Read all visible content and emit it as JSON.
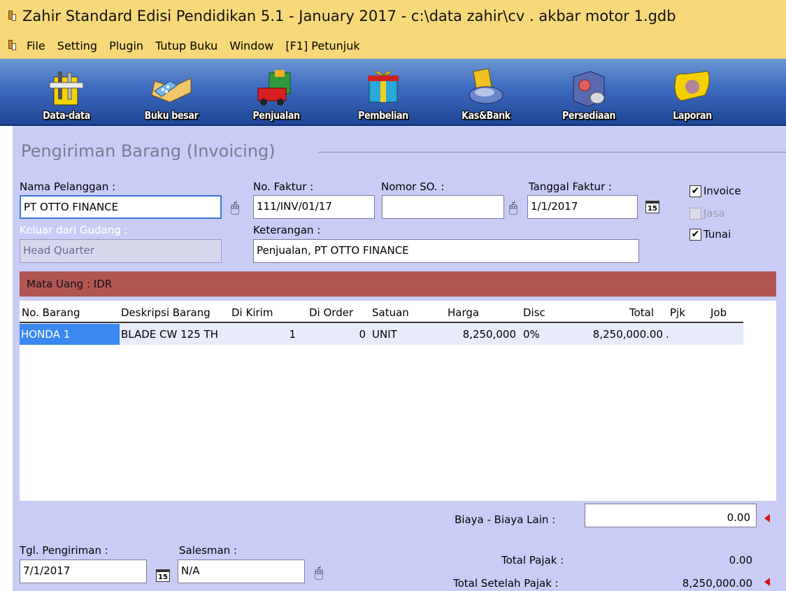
{
  "window": {
    "title": "Zahir Standard Edisi Pendidikan 5.1 - January 2017 - c:\\data zahir\\cv . akbar motor 1.gdb"
  },
  "menu": {
    "items": [
      "File",
      "Setting",
      "Plugin",
      "Tutup Buku",
      "Window",
      "[F1] Petunjuk"
    ]
  },
  "toolbar": {
    "buttons": [
      {
        "label": "Data-data",
        "icon": "data-data-icon"
      },
      {
        "label": "Buku besar",
        "icon": "ledger-book-icon"
      },
      {
        "label": "Penjualan",
        "icon": "sales-truck-icon"
      },
      {
        "label": "Pembelian",
        "icon": "purchase-gift-icon"
      },
      {
        "label": "Kas&Bank",
        "icon": "cash-bank-icon"
      },
      {
        "label": "Persediaan",
        "icon": "inventory-icon"
      },
      {
        "label": "Laporan",
        "icon": "report-scroll-icon"
      }
    ]
  },
  "form": {
    "section_title": "Pengiriman Barang (Invoicing)",
    "customer": {
      "label": "Nama Pelanggan :",
      "value": "PT OTTO FINANCE"
    },
    "invoice_no": {
      "label": "No. Faktur :",
      "value": "111/INV/01/17"
    },
    "so_no": {
      "label": "Nomor SO. :",
      "value": ""
    },
    "invoice_date": {
      "label": "Tanggal Faktur :",
      "value": "1/1/2017"
    },
    "calendar_label": "15",
    "warehouse": {
      "label": "Keluar dari Gudang :",
      "value": "Head Quarter"
    },
    "notes": {
      "label": "Keterangan :",
      "value": "Penjualan, PT OTTO FINANCE"
    },
    "checkboxes": {
      "invoice": {
        "label": "Invoice",
        "checked": true
      },
      "jasa": {
        "label": "Jasa",
        "checked": false
      },
      "tunai": {
        "label": "Tunai",
        "checked": true
      }
    },
    "currency": "Mata Uang : IDR"
  },
  "grid": {
    "headers": [
      "No. Barang",
      "Deskripsi Barang",
      "Di Kirim",
      "Di Order",
      "Satuan",
      "Harga",
      "Disc",
      "Total",
      "Pjk",
      "Job"
    ],
    "rows": [
      {
        "no": "HONDA 1",
        "desc": "BLADE CW 125 TH",
        "kirim": "1",
        "order": "0",
        "satuan": "UNIT",
        "harga": "8,250,000",
        "disc": "0%",
        "total": "8,250,000.00",
        "pjk": ".",
        "job": ""
      }
    ]
  },
  "footer": {
    "other_costs": {
      "label": "Biaya - Biaya Lain :",
      "value": "0.00"
    },
    "ship_date": {
      "label": "Tgl. Pengiriman :",
      "value": "7/1/2017"
    },
    "salesman": {
      "label": "Salesman :",
      "value": "N/A"
    },
    "total_tax": {
      "label": "Total Pajak :",
      "value": "0.00"
    },
    "total_after_tax": {
      "label": "Total Setelah Pajak :",
      "value": "8,250,000.00"
    }
  },
  "colors": {
    "title_bar": "#f7d97a",
    "toolbar": "#3d6bbf",
    "panel": "#c9cdf6",
    "currency_bar": "#b15653",
    "selection": "#3a88f0"
  }
}
